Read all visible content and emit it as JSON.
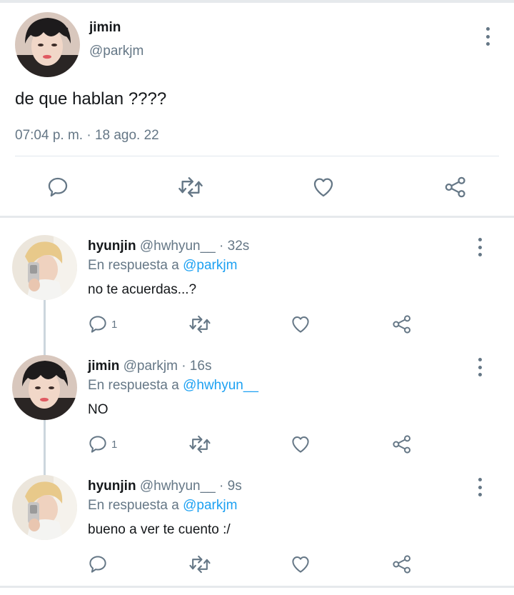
{
  "main_tweet": {
    "name": "jimin",
    "handle": "@parkjm",
    "text": "de que hablan ????",
    "timestamp": "07:04 p. m. · 18 ago. 22",
    "actions": [
      "reply-icon",
      "retweet-icon",
      "like-icon",
      "share-icon"
    ]
  },
  "replies": [
    {
      "name": "hyunjin",
      "meta": "@hwhyun__ · 32s",
      "reply_prefix": "En respuesta a",
      "reply_to": "@parkjm",
      "text": "no te acuerdas...?",
      "reply_count": "1"
    },
    {
      "name": "jimin",
      "meta": "@parkjm · 16s",
      "reply_prefix": "En respuesta a",
      "reply_to": "@hwhyun__",
      "text": "NO",
      "reply_count": "1"
    },
    {
      "name": "hyunjin",
      "meta": "@hwhyun__ · 9s",
      "reply_prefix": "En respuesta a",
      "reply_to": "@parkjm",
      "text": "bueno a ver te cuento :/",
      "reply_count": ""
    }
  ],
  "colors": {
    "link": "#1da1f2",
    "secondary_text": "#657786",
    "icon": "#657786"
  }
}
